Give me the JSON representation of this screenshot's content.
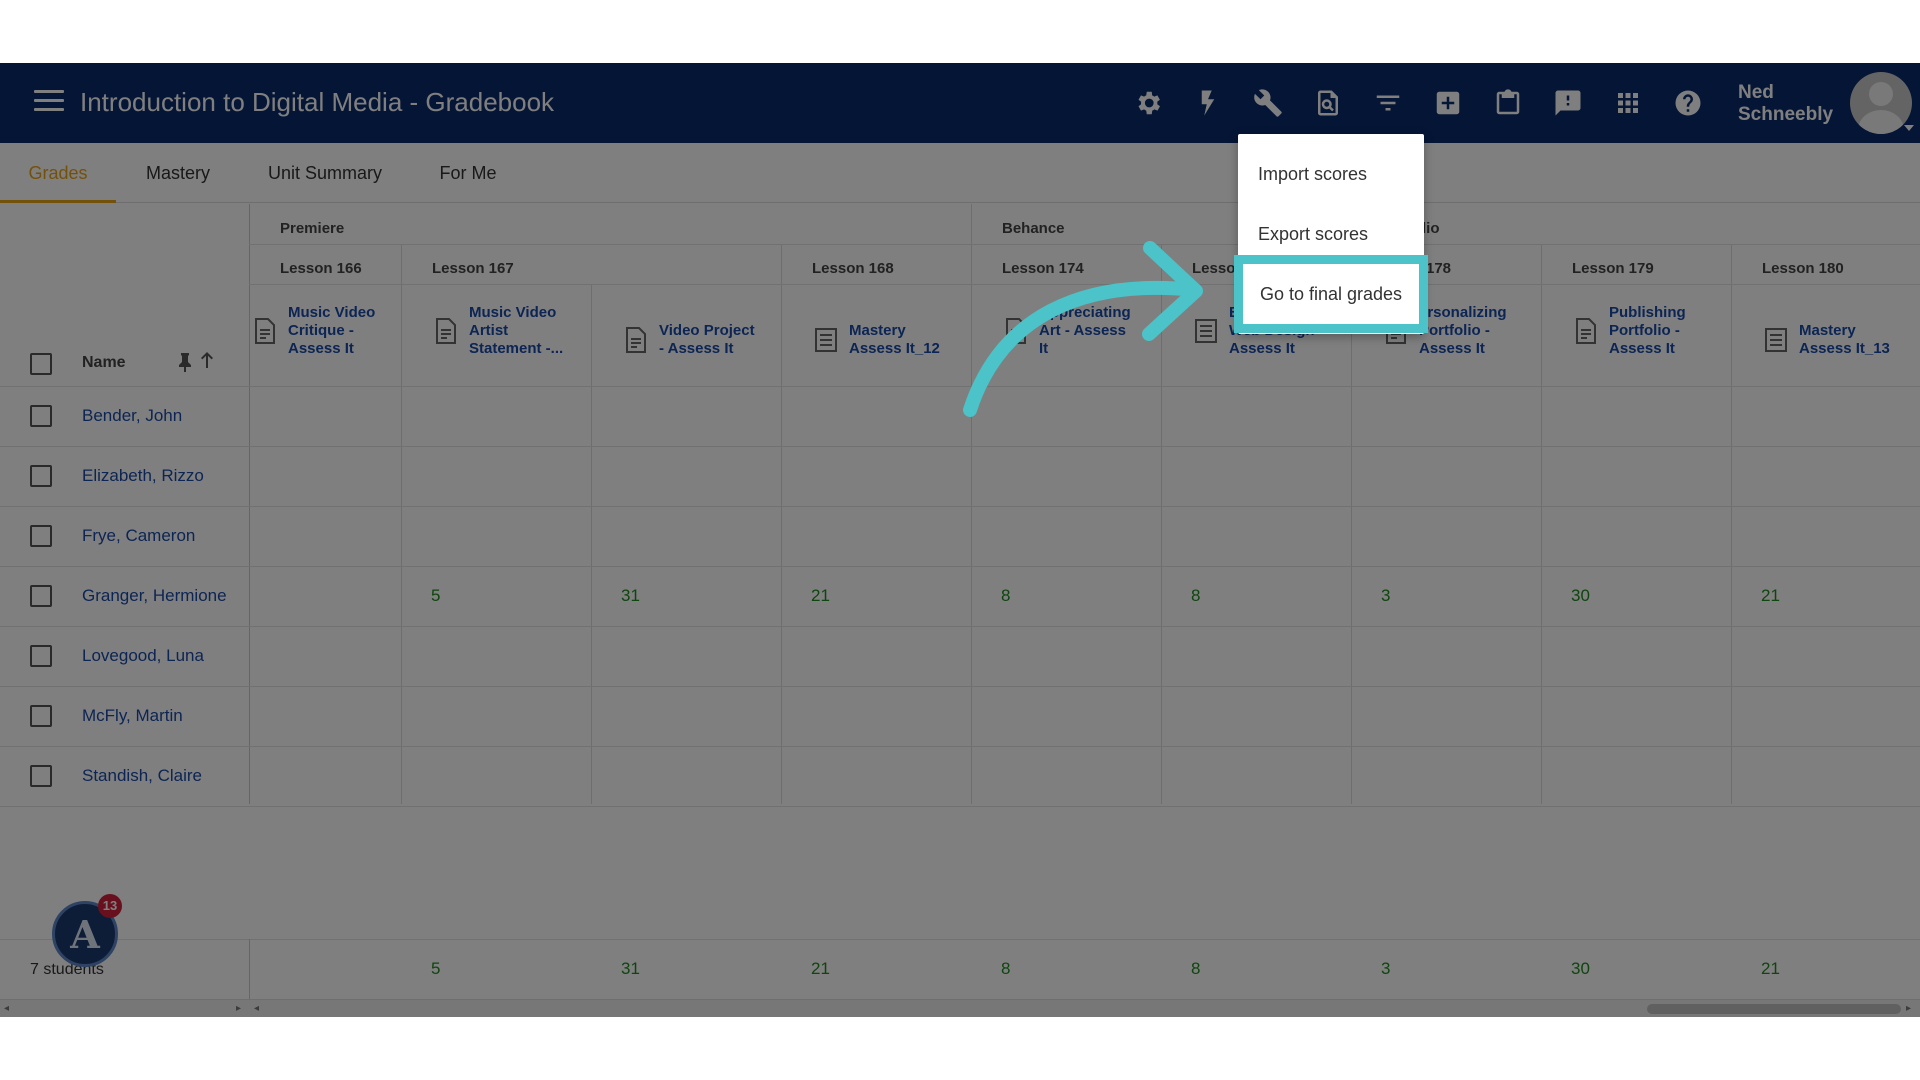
{
  "header": {
    "title": "Introduction to Digital Media - Gradebook",
    "user_name_line1": "Ned",
    "user_name_line2": "Schneebly"
  },
  "toolbar_icons": [
    "gear-icon",
    "lightning-icon",
    "wrench-icon",
    "search-document-icon",
    "filter-icon",
    "add-box-icon",
    "clipboard-icon",
    "feedback-icon",
    "apps-grid-icon",
    "help-icon"
  ],
  "tabs": [
    {
      "label": "Grades",
      "active": true
    },
    {
      "label": "Mastery",
      "active": false
    },
    {
      "label": "Unit Summary",
      "active": false
    },
    {
      "label": "For Me",
      "active": false
    }
  ],
  "categories": [
    "Premiere",
    "Behance",
    "lio"
  ],
  "lessons": [
    "Lesson 166",
    "Lesson 167",
    "Lesson 168",
    "Lesson 174",
    "Lesso",
    "178",
    "Lesson 179",
    "Lesson 180"
  ],
  "assignments": [
    {
      "line1": "Music Video",
      "line2": "Critique -",
      "line3": "Assess It"
    },
    {
      "line1": "Music Video",
      "line2": "Artist",
      "line3": "Statement -..."
    },
    {
      "line1": "Video Project",
      "line2": "- Assess It",
      "line3": ""
    },
    {
      "line1": "Mastery",
      "line2": "Assess It_12",
      "line3": ""
    },
    {
      "line1": "Appreciating",
      "line2": "Art - Assess",
      "line3": "It"
    },
    {
      "line1": "E",
      "line2": "Web Design -",
      "line3": "Assess It"
    },
    {
      "line1": "ersonalizing",
      "line2": "Portfolio -",
      "line3": "Assess It"
    },
    {
      "line1": "Publishing",
      "line2": "Portfolio -",
      "line3": "Assess It"
    },
    {
      "line1": "Mastery",
      "line2": "Assess It_13",
      "line3": ""
    }
  ],
  "name_header": "Name",
  "students": [
    "Bender, John",
    "Elizabeth, Rizzo",
    "Frye, Cameron",
    "Granger, Hermione",
    "Lovegood, Luna",
    "McFly, Martin",
    "Standish, Claire"
  ],
  "scores_granger": [
    "5",
    "31",
    "21",
    "8",
    "8",
    "3",
    "30",
    "21"
  ],
  "footer": {
    "student_count": "7 students",
    "scores": [
      "5",
      "31",
      "21",
      "8",
      "8",
      "3",
      "30",
      "21"
    ]
  },
  "badge_count": "13",
  "menu": {
    "import": "Import scores",
    "export": "Export scores",
    "final": "Go to final grades"
  },
  "colors": {
    "header_bg": "#0a2b6b",
    "tab_active": "#e8a317",
    "link": "#1a4aa8",
    "score": "#1e8a1e",
    "highlight": "#4bc3c8"
  }
}
